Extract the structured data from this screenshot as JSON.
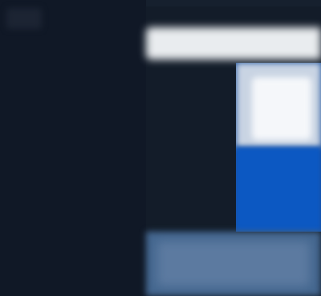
{
  "colors": {
    "background": "#121a26",
    "sidebar": "#101826",
    "topbar": "#e9ecef",
    "panel_light": "#f5f7fa",
    "panel_accent": "#0c58c2",
    "footer": "#44678f"
  }
}
